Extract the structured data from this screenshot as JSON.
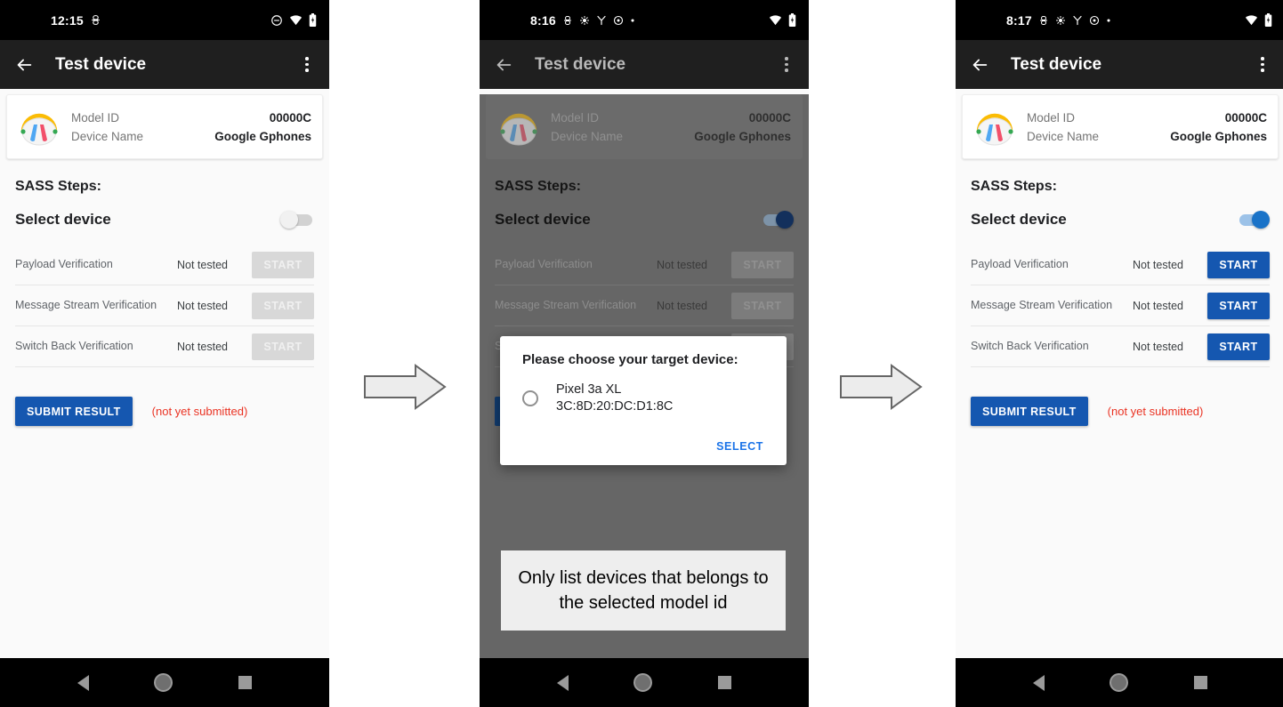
{
  "panels": [
    {
      "id": "panel-initial",
      "statusbar": {
        "time": "12:15",
        "left_icons": [
          "android-debug-icon"
        ],
        "right_icons": [
          "do-not-disturb-icon",
          "wifi-icon",
          "battery-icon"
        ]
      },
      "appbar": {
        "back_icon": "back-arrow-icon",
        "title": "Test device",
        "overflow_icon": "overflow-menu-icon"
      },
      "device_card": {
        "icon": "headphones-icon",
        "rows": [
          {
            "label": "Model ID",
            "value": "00000C"
          },
          {
            "label": "Device Name",
            "value": "Google Gphones"
          }
        ]
      },
      "sass": {
        "heading": "SASS Steps:",
        "select_device_label": "Select device",
        "toggle_state": "off",
        "tests": [
          {
            "name": "Payload Verification",
            "status": "Not tested",
            "button": "START",
            "enabled": false
          },
          {
            "name": "Message Stream Verification",
            "status": "Not tested",
            "button": "START",
            "enabled": false
          },
          {
            "name": "Switch Back Verification",
            "status": "Not tested",
            "button": "START",
            "enabled": false
          }
        ]
      },
      "submit": {
        "button": "SUBMIT RESULT",
        "note": "(not yet submitted)"
      },
      "navbar": [
        "back-nav-icon",
        "home-nav-icon",
        "recents-nav-icon"
      ]
    },
    {
      "id": "panel-dialog",
      "statusbar": {
        "time": "8:16",
        "left_icons": [
          "android-debug-icon",
          "sync-icon",
          "vpn-icon",
          "settings-icon",
          "dot-icon"
        ],
        "right_icons": [
          "wifi-icon",
          "battery-icon"
        ]
      },
      "appbar": {
        "back_icon": "back-arrow-icon",
        "title": "Test device",
        "overflow_icon": "overflow-menu-icon"
      },
      "device_card": {
        "icon": "headphones-icon",
        "rows": [
          {
            "label": "Model ID",
            "value": "00000C"
          },
          {
            "label": "Device Name",
            "value": "Google Gphones"
          }
        ]
      },
      "sass": {
        "heading": "SASS Steps:",
        "select_device_label": "Select device",
        "toggle_state": "on",
        "tests": [
          {
            "name": "Payload Verification",
            "status": "Not tested",
            "button": "START",
            "enabled": false
          },
          {
            "name": "Message Stream Verification",
            "status": "Not tested",
            "button": "START",
            "enabled": false
          },
          {
            "name": "Switch Back Verification",
            "status": "Not tested",
            "button": "START",
            "enabled": false
          }
        ]
      },
      "submit": {
        "button": "SUBMIT RESULT",
        "note": "(not yet submitted)"
      },
      "dialog": {
        "title": "Please choose your target device:",
        "options": [
          {
            "name": "Pixel 3a XL",
            "mac": "3C:8D:20:DC:D1:8C",
            "selected": false
          }
        ],
        "action": "SELECT"
      },
      "callout": "Only list devices that belongs to the selected model id",
      "navbar": [
        "back-nav-icon",
        "home-nav-icon",
        "recents-nav-icon"
      ]
    },
    {
      "id": "panel-selected",
      "statusbar": {
        "time": "8:17",
        "left_icons": [
          "android-debug-icon",
          "sync-icon",
          "vpn-icon",
          "settings-icon",
          "dot-icon"
        ],
        "right_icons": [
          "wifi-icon",
          "battery-icon"
        ]
      },
      "appbar": {
        "back_icon": "back-arrow-icon",
        "title": "Test device",
        "overflow_icon": "overflow-menu-icon"
      },
      "device_card": {
        "icon": "headphones-icon",
        "rows": [
          {
            "label": "Model ID",
            "value": "00000C"
          },
          {
            "label": "Device Name",
            "value": "Google Gphones"
          }
        ]
      },
      "sass": {
        "heading": "SASS Steps:",
        "select_device_label": "Select device",
        "toggle_state": "on",
        "tests": [
          {
            "name": "Payload Verification",
            "status": "Not tested",
            "button": "START",
            "enabled": true
          },
          {
            "name": "Message Stream Verification",
            "status": "Not tested",
            "button": "START",
            "enabled": true
          },
          {
            "name": "Switch Back Verification",
            "status": "Not tested",
            "button": "START",
            "enabled": true
          }
        ]
      },
      "submit": {
        "button": "SUBMIT RESULT",
        "note": "(not yet submitted)"
      },
      "navbar": [
        "back-nav-icon",
        "home-nav-icon",
        "recents-nav-icon"
      ]
    }
  ],
  "flow_arrows": [
    {
      "name": "flow-arrow-1",
      "icon": "right-arrow-icon"
    },
    {
      "name": "flow-arrow-2",
      "icon": "right-arrow-icon"
    }
  ],
  "colors": {
    "accent_blue": "#1557b0",
    "link_blue": "#1a73e8",
    "error_red": "#ea3323",
    "scrim": "#666666",
    "appbar": "#1f1f1f",
    "statusbar": "#000000",
    "disabled_button": "#d8d8d8"
  }
}
